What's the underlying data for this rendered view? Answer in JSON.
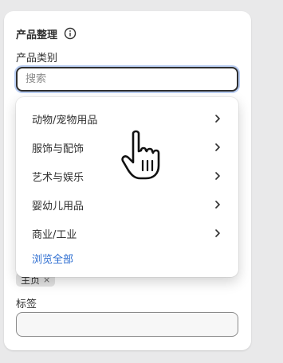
{
  "section": {
    "title": "产品整理",
    "info_icon": "info-icon"
  },
  "category": {
    "label": "产品类别",
    "search_placeholder": "搜索",
    "search_value": ""
  },
  "dropdown": {
    "items": [
      {
        "label": "动物/宠物用品",
        "icon": "chevron-right-icon"
      },
      {
        "label": "服饰与配饰",
        "icon": "chevron-right-icon"
      },
      {
        "label": "艺术与娱乐",
        "icon": "chevron-right-icon"
      },
      {
        "label": "婴幼儿用品",
        "icon": "chevron-right-icon"
      },
      {
        "label": "商业/工业",
        "icon": "chevron-right-icon"
      }
    ],
    "browse_all": "浏览全部"
  },
  "partially_hidden_chip": {
    "label": "主页",
    "remove_icon": "×"
  },
  "tags": {
    "label": "标签",
    "value": ""
  },
  "colors": {
    "accent_link": "#2b6cd0",
    "focus_ring": "#b9cdf2",
    "text": "#303030"
  }
}
